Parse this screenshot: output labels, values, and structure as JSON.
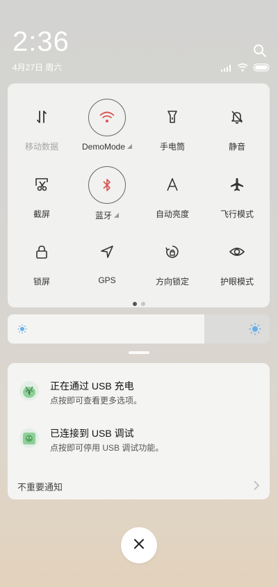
{
  "status": {
    "time": "2:36",
    "date": "4月27日 周六",
    "icons": [
      "signal-icon",
      "wifi-icon",
      "battery-icon"
    ]
  },
  "quick_settings": {
    "tiles": [
      {
        "label": "移动数据",
        "icon": "mobile-data-icon",
        "active": false
      },
      {
        "label": "DemoMode",
        "icon": "wifi-icon",
        "active": true,
        "accent": "#d9534f"
      },
      {
        "label": "手电筒",
        "icon": "flashlight-icon",
        "active": false
      },
      {
        "label": "静音",
        "icon": "mute-bell-icon",
        "active": false
      },
      {
        "label": "截屏",
        "icon": "screenshot-icon",
        "active": false
      },
      {
        "label": "蓝牙",
        "icon": "bluetooth-icon",
        "active": true,
        "accent": "#d9534f"
      },
      {
        "label": "自动亮度",
        "icon": "auto-brightness-icon",
        "active": false
      },
      {
        "label": "飞行模式",
        "icon": "airplane-icon",
        "active": false
      },
      {
        "label": "锁屏",
        "icon": "lock-icon",
        "active": false
      },
      {
        "label": "GPS",
        "icon": "location-arrow-icon",
        "active": false
      },
      {
        "label": "方向锁定",
        "icon": "rotation-lock-icon",
        "active": false
      },
      {
        "label": "护眼模式",
        "icon": "eye-icon",
        "active": false
      }
    ],
    "page_count": 2,
    "current_page": 1
  },
  "brightness": {
    "level": 0.75,
    "sun_color": "#6aaee8"
  },
  "notifications": {
    "items": [
      {
        "title": "正在通过 USB 充电",
        "subtitle": "点按即可查看更多选项。",
        "icon": "usb-charge-icon"
      },
      {
        "title": "已连接到 USB 调试",
        "subtitle": "点按即可停用 USB 调试功能。",
        "icon": "usb-debug-icon"
      }
    ],
    "unimportant_label": "不重要通知"
  },
  "close_icon": "close-icon"
}
